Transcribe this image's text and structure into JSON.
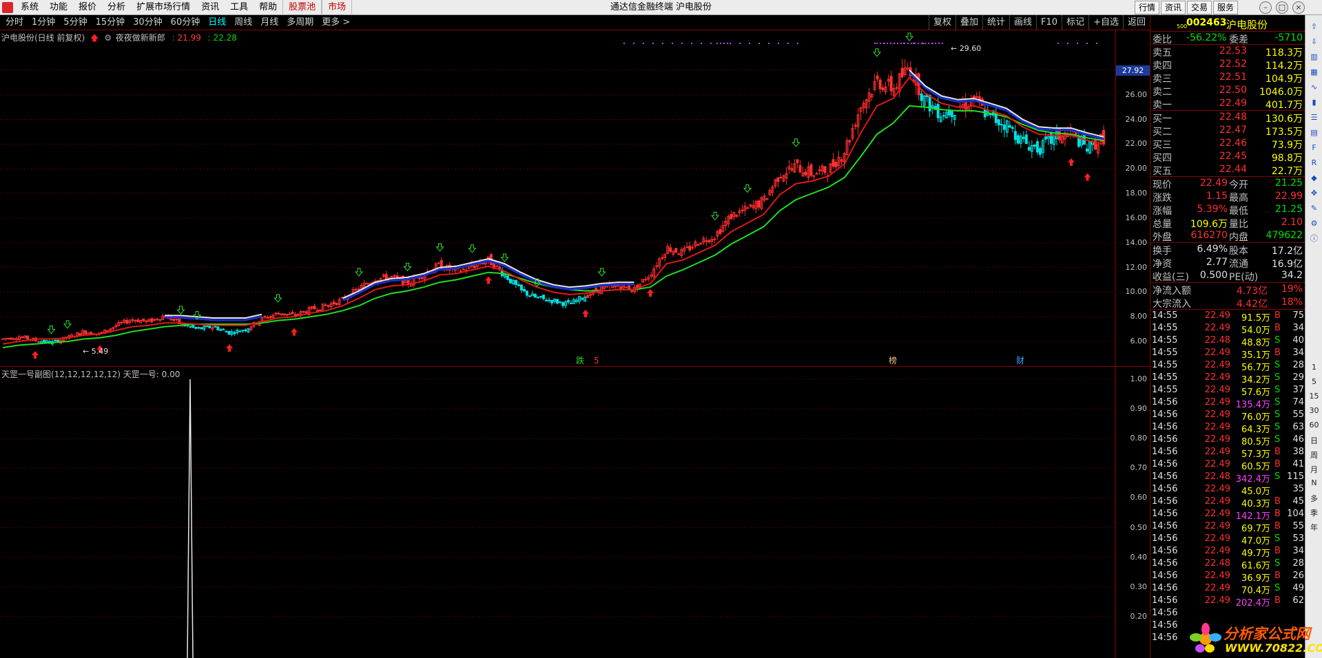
{
  "menu": [
    "系统",
    "功能",
    "报价",
    "分析",
    "扩展市场行情",
    "资讯",
    "工具",
    "帮助",
    "股票池",
    "市场"
  ],
  "window_title": "通达信金融终端  沪电股份",
  "top_right_tabs": [
    "行情",
    "资讯",
    "交易",
    "服务"
  ],
  "periods": [
    "分时",
    "1分钟",
    "5分钟",
    "15分钟",
    "30分钟",
    "60分钟",
    "日线",
    "周线",
    "月线",
    "多周期",
    "更多 >"
  ],
  "active_period": "日线",
  "chart_tools": [
    "复权",
    "叠加",
    "统计",
    "画线",
    "F10",
    "标记",
    "+自选",
    "返回"
  ],
  "main_legend": {
    "stock": "沪电股份(日线 前复权)",
    "indicator": "夜夜做新新郎",
    "v1": ": 21.99",
    "v2": ": 22.28"
  },
  "sub_legend": "天罡一号副图(12,12,12,12,12)  天罡一号: 0.00",
  "colors": {
    "up": "#ff3030",
    "down": "#00e0e0",
    "ma_red": "#e01818",
    "ma_green": "#20e020",
    "ma_white": "#e8e8e8",
    "ma_blue": "#1a2fd0"
  },
  "chart_data": [
    {
      "type": "candlestick",
      "title": "沪电股份(日线 前复权)",
      "ylim": [
        5,
        30
      ],
      "y_ticks": [
        "28.00",
        "26.00",
        "24.00",
        "22.00",
        "20.00",
        "18.00",
        "16.00",
        "14.00",
        "12.00",
        "10.00",
        "8.00",
        "6.00"
      ],
      "last_price_label": "27.92",
      "annotations": {
        "high": "29.60",
        "low": "5.49"
      },
      "markers": [
        "跌",
        "5",
        "榜",
        "财"
      ],
      "close_series": [
        6.2,
        6.4,
        6.1,
        5.9,
        6.3,
        6.8,
        6.6,
        7.3,
        7.8,
        7.6,
        8.1,
        7.4,
        7.0,
        7.2,
        6.7,
        7.0,
        7.8,
        8.3,
        8.1,
        8.6,
        8.9,
        9.4,
        10.3,
        11.1,
        11.2,
        10.7,
        11.5,
        12.2,
        11.6,
        12.1,
        12.6,
        11.4,
        10.1,
        9.5,
        9.3,
        9.0,
        9.7,
        10.3,
        10.5,
        10.2,
        11.5,
        13.6,
        13.2,
        14.1,
        14.6,
        16.2,
        16.7,
        17.4,
        19.6,
        20.2,
        19.6,
        19.9,
        21.5,
        25.1,
        27.1,
        26.5,
        28.3,
        25.4,
        24.5,
        24.9,
        25.6,
        24.1,
        23.6,
        22.2,
        21.6,
        22.5,
        22.9,
        21.6,
        22.49
      ],
      "ma_red": [
        5.8,
        6.0,
        6.2,
        6.2,
        6.3,
        6.5,
        6.6,
        6.9,
        7.2,
        7.3,
        7.5,
        7.5,
        7.4,
        7.3,
        7.3,
        7.3,
        7.6,
        7.9,
        8.0,
        8.3,
        8.5,
        8.9,
        9.5,
        10.2,
        10.5,
        10.6,
        10.9,
        11.4,
        11.5,
        11.8,
        12.1,
        11.7,
        11.0,
        10.4,
        10.0,
        9.8,
        9.9,
        10.1,
        10.2,
        10.2,
        10.7,
        12.3,
        12.6,
        13.2,
        13.8,
        14.9,
        15.6,
        16.3,
        17.9,
        18.8,
        19.0,
        19.4,
        20.4,
        22.9,
        25.1,
        25.7,
        27.4,
        26.1,
        25.3,
        25.0,
        25.1,
        24.7,
        24.3,
        23.4,
        22.8,
        22.7,
        22.7,
        22.3,
        21.99
      ],
      "ma_green": [
        5.5,
        5.7,
        5.8,
        5.9,
        6.0,
        6.2,
        6.3,
        6.5,
        6.8,
        7.0,
        7.2,
        7.3,
        7.4,
        7.4,
        7.4,
        7.4,
        7.5,
        7.7,
        7.8,
        8.0,
        8.2,
        8.5,
        8.9,
        9.5,
        9.9,
        10.1,
        10.4,
        10.8,
        11.0,
        11.3,
        11.6,
        11.5,
        11.1,
        10.7,
        10.4,
        10.2,
        10.1,
        10.1,
        10.2,
        10.2,
        10.4,
        11.3,
        11.8,
        12.4,
        13.0,
        13.9,
        14.6,
        15.3,
        16.6,
        17.5,
        18.0,
        18.5,
        19.3,
        21.0,
        22.8,
        23.7,
        25.1,
        25.0,
        24.8,
        24.7,
        24.7,
        24.5,
        24.2,
        23.6,
        23.1,
        22.9,
        22.8,
        22.5,
        22.28
      ]
    },
    {
      "type": "line",
      "title": "天罡一号副图",
      "ylim": [
        0,
        1
      ],
      "y_ticks": [
        "1.00",
        "0.90",
        "0.80",
        "0.70",
        "0.60",
        "0.50",
        "0.40",
        "0.30",
        "0.20"
      ],
      "spike_value": 1.0
    }
  ],
  "quote": {
    "code": "002463",
    "name": "沪电股份",
    "wei_bi_label": "委比",
    "wei_bi": "-56.22%",
    "wei_cha_label": "委差",
    "wei_cha": "-5710",
    "sell": [
      {
        "label": "卖五",
        "price": "22.53",
        "vol": "118.3万"
      },
      {
        "label": "卖四",
        "price": "22.52",
        "vol": "114.2万"
      },
      {
        "label": "卖三",
        "price": "22.51",
        "vol": "104.9万"
      },
      {
        "label": "卖二",
        "price": "22.50",
        "vol": "1046.0万"
      },
      {
        "label": "卖一",
        "price": "22.49",
        "vol": "401.7万"
      }
    ],
    "buy": [
      {
        "label": "买一",
        "price": "22.48",
        "vol": "130.6万"
      },
      {
        "label": "买二",
        "price": "22.47",
        "vol": "173.5万"
      },
      {
        "label": "买三",
        "price": "22.46",
        "vol": "73.9万"
      },
      {
        "label": "买四",
        "price": "22.45",
        "vol": "98.8万"
      },
      {
        "label": "买五",
        "price": "22.44",
        "vol": "22.7万"
      }
    ],
    "stats": [
      {
        "l1": "现价",
        "v1": "22.49",
        "c1": "red",
        "l2": "今开",
        "v2": "21.25",
        "c2": "green"
      },
      {
        "l1": "涨跌",
        "v1": "1.15",
        "c1": "red",
        "l2": "最高",
        "v2": "22.99",
        "c2": "red"
      },
      {
        "l1": "涨幅",
        "v1": "5.39%",
        "c1": "red",
        "l2": "最低",
        "v2": "21.25",
        "c2": "green"
      },
      {
        "l1": "总量",
        "v1": "109.6万",
        "c1": "yellow",
        "l2": "量比",
        "v2": "2.10",
        "c2": "red"
      },
      {
        "l1": "外盘",
        "v1": "616270",
        "c1": "red",
        "l2": "内盘",
        "v2": "479622",
        "c2": "green"
      }
    ],
    "fundamentals": [
      {
        "l1": "换手",
        "v1": "6.49%",
        "l2": "股本",
        "v2": "17.2亿"
      },
      {
        "l1": "净资",
        "v1": "2.77",
        "l2": "流通",
        "v2": "16.9亿"
      },
      {
        "l1": "收益(三)",
        "v1": "0.500",
        "l2": "PE(动)",
        "v2": "34.2"
      }
    ],
    "flows": [
      {
        "label": "净流入额",
        "value": "4.73亿",
        "pct": "19%"
      },
      {
        "label": "大宗流入",
        "value": "4.42亿",
        "pct": "18%"
      }
    ],
    "ticks": [
      {
        "t": "14:55",
        "p": "22.49",
        "pc": "red",
        "v": "91.5万",
        "vc": "yellow",
        "f": "B",
        "n": "75"
      },
      {
        "t": "14:55",
        "p": "22.49",
        "pc": "red",
        "v": "54.0万",
        "vc": "yellow",
        "f": "B",
        "n": "34"
      },
      {
        "t": "14:55",
        "p": "22.48",
        "pc": "red",
        "v": "48.8万",
        "vc": "yellow",
        "f": "S",
        "n": "40"
      },
      {
        "t": "14:55",
        "p": "22.49",
        "pc": "red",
        "v": "35.1万",
        "vc": "yellow",
        "f": "B",
        "n": "34"
      },
      {
        "t": "14:55",
        "p": "22.49",
        "pc": "red",
        "v": "56.7万",
        "vc": "yellow",
        "f": "S",
        "n": "28"
      },
      {
        "t": "14:55",
        "p": "22.49",
        "pc": "red",
        "v": "34.2万",
        "vc": "yellow",
        "f": "S",
        "n": "29"
      },
      {
        "t": "14:55",
        "p": "22.49",
        "pc": "red",
        "v": "57.6万",
        "vc": "yellow",
        "f": "S",
        "n": "37"
      },
      {
        "t": "14:56",
        "p": "22.49",
        "pc": "red",
        "v": "135.4万",
        "vc": "magenta",
        "f": "S",
        "n": "74"
      },
      {
        "t": "14:56",
        "p": "22.49",
        "pc": "red",
        "v": "76.0万",
        "vc": "yellow",
        "f": "S",
        "n": "55"
      },
      {
        "t": "14:56",
        "p": "22.49",
        "pc": "red",
        "v": "64.3万",
        "vc": "yellow",
        "f": "S",
        "n": "63"
      },
      {
        "t": "14:56",
        "p": "22.49",
        "pc": "red",
        "v": "80.5万",
        "vc": "yellow",
        "f": "S",
        "n": "46"
      },
      {
        "t": "14:56",
        "p": "22.49",
        "pc": "red",
        "v": "57.3万",
        "vc": "yellow",
        "f": "B",
        "n": "38"
      },
      {
        "t": "14:56",
        "p": "22.49",
        "pc": "red",
        "v": "60.5万",
        "vc": "yellow",
        "f": "B",
        "n": "41"
      },
      {
        "t": "14:56",
        "p": "22.48",
        "pc": "red",
        "v": "342.4万",
        "vc": "magenta",
        "f": "S",
        "n": "115"
      },
      {
        "t": "14:56",
        "p": "22.49",
        "pc": "red",
        "v": "45.0万",
        "vc": "yellow",
        "f": "",
        "n": "35"
      },
      {
        "t": "14:56",
        "p": "22.49",
        "pc": "red",
        "v": "40.3万",
        "vc": "yellow",
        "f": "B",
        "n": "45"
      },
      {
        "t": "14:56",
        "p": "22.49",
        "pc": "red",
        "v": "142.1万",
        "vc": "magenta",
        "f": "B",
        "n": "104"
      },
      {
        "t": "14:56",
        "p": "22.49",
        "pc": "red",
        "v": "69.7万",
        "vc": "yellow",
        "f": "B",
        "n": "55"
      },
      {
        "t": "14:56",
        "p": "22.49",
        "pc": "red",
        "v": "47.0万",
        "vc": "yellow",
        "f": "S",
        "n": "53"
      },
      {
        "t": "14:56",
        "p": "22.49",
        "pc": "red",
        "v": "49.7万",
        "vc": "yellow",
        "f": "B",
        "n": "34"
      },
      {
        "t": "14:56",
        "p": "22.48",
        "pc": "red",
        "v": "61.6万",
        "vc": "yellow",
        "f": "S",
        "n": "28"
      },
      {
        "t": "14:56",
        "p": "22.49",
        "pc": "red",
        "v": "36.9万",
        "vc": "yellow",
        "f": "B",
        "n": "26"
      },
      {
        "t": "14:56",
        "p": "22.49",
        "pc": "red",
        "v": "70.4万",
        "vc": "yellow",
        "f": "S",
        "n": "49"
      },
      {
        "t": "14:56",
        "p": "22.49",
        "pc": "red",
        "v": "202.4万",
        "vc": "magenta",
        "f": "B",
        "n": "62"
      },
      {
        "t": "14:56",
        "p": "",
        "pc": "red",
        "v": "",
        "vc": "yellow",
        "f": "",
        "n": ""
      },
      {
        "t": "14:56",
        "p": "",
        "pc": "red",
        "v": "",
        "vc": "yellow",
        "f": "",
        "n": ""
      },
      {
        "t": "14:56",
        "p": "",
        "pc": "red",
        "v": "",
        "vc": "yellow",
        "f": "",
        "n": ""
      }
    ]
  },
  "sidebar_labels": [
    "1",
    "5",
    "15",
    "30",
    "60",
    "日",
    "周",
    "月",
    "N",
    "多",
    "季",
    "年"
  ],
  "sidebar_icons": [
    "up-arrow-icon",
    "down-arrow-icon",
    "bar-chart-icon",
    "grid-icon",
    "line-chart-icon",
    "candle-icon",
    "list-icon",
    "table-icon",
    "f10-icon",
    "rss-icon",
    "shield-icon",
    "expand-icon",
    "pencil-icon",
    "settings-icon",
    "info-icon"
  ],
  "watermark": {
    "line1": "分析家公式网",
    "line2": "WWW.70822.COM"
  }
}
